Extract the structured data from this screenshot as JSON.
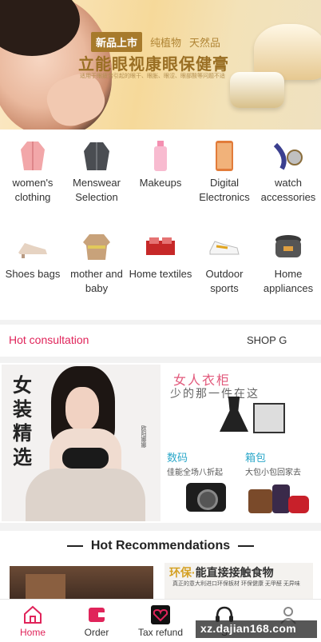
{
  "banner": {
    "tag_new": "新品上市",
    "tag_plant": "纯植物",
    "tag_natural": "天然品",
    "title": "立能眼视康眼保健膏",
    "subtitle": "适用于眼疲劳引起的眼干、眼胀、眼涩、眼部酸等问题不适"
  },
  "categories": [
    {
      "label": "women's clothing",
      "icon": "coat-icon"
    },
    {
      "label": "Menswear Selection",
      "icon": "jacket-icon"
    },
    {
      "label": "Makeups",
      "icon": "lotion-icon"
    },
    {
      "label": "Digital Electronics",
      "icon": "phone-icon"
    },
    {
      "label": "watch accessories",
      "icon": "watch-icon"
    },
    {
      "label": "Shoes bags",
      "icon": "shoe-icon"
    },
    {
      "label": "mother and baby",
      "icon": "baby-dress-icon"
    },
    {
      "label": "Home textiles",
      "icon": "bed-icon"
    },
    {
      "label": "Outdoor sports",
      "icon": "sneaker-icon"
    },
    {
      "label": "Home appliances",
      "icon": "rice-cooker-icon"
    }
  ],
  "hot_consultation": {
    "label": "Hot consultation",
    "right": "SHOP G"
  },
  "promo": {
    "left_title": "女装精选",
    "left_signature": "欧阳娜娜",
    "right_title": "女人衣柜",
    "right_subtitle": "少的那一件在这",
    "digital_title": "数码",
    "digital_sub": "佳能全场八折起",
    "bags_title": "箱包",
    "bags_sub": "大包小包回家去"
  },
  "recommendations": {
    "heading": "Hot Recommendations",
    "card2_title_hl": "环保·",
    "card2_title": "能直接接触食物",
    "card2_sub": "真正的意大利进口环保板材 环保健康 无甲醛 无异味"
  },
  "tabs": [
    {
      "label": "Home",
      "active": true
    },
    {
      "label": "Order",
      "active": false
    },
    {
      "label": "Tax refund",
      "active": false
    },
    {
      "label": "S",
      "active": false
    },
    {
      "label": "",
      "active": false
    }
  ],
  "watermark": "xz.dajian168.com",
  "colors": {
    "accent": "#e0245a",
    "link_blue": "#2aa7c9"
  }
}
